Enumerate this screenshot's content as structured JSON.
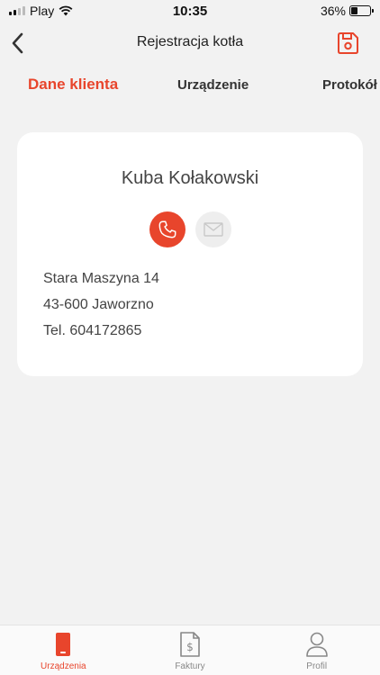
{
  "status_bar": {
    "carrier": "Play",
    "time": "10:35",
    "battery": "36%",
    "battery_level": 0.36
  },
  "nav": {
    "title": "Rejestracja kotła",
    "back_icon": "chevron-left-icon",
    "save_icon": "save-icon"
  },
  "tabs": [
    {
      "label": "Dane klienta",
      "active": true
    },
    {
      "label": "Urządzenie",
      "active": false
    },
    {
      "label": "Protokół",
      "active": false
    }
  ],
  "client": {
    "name": "Kuba Kołakowski",
    "address_line1": "Stara Maszyna 14",
    "address_line2": "43-600 Jaworzno",
    "phone_line": "Tel. 604172865"
  },
  "bottom_nav": [
    {
      "label": "Urządzenia",
      "icon": "device-icon",
      "active": true
    },
    {
      "label": "Faktury",
      "icon": "invoice-icon",
      "active": false
    },
    {
      "label": "Profil",
      "icon": "profile-icon",
      "active": false
    }
  ],
  "colors": {
    "accent": "#e8452c",
    "background": "#f2f2f2",
    "card": "#ffffff"
  }
}
